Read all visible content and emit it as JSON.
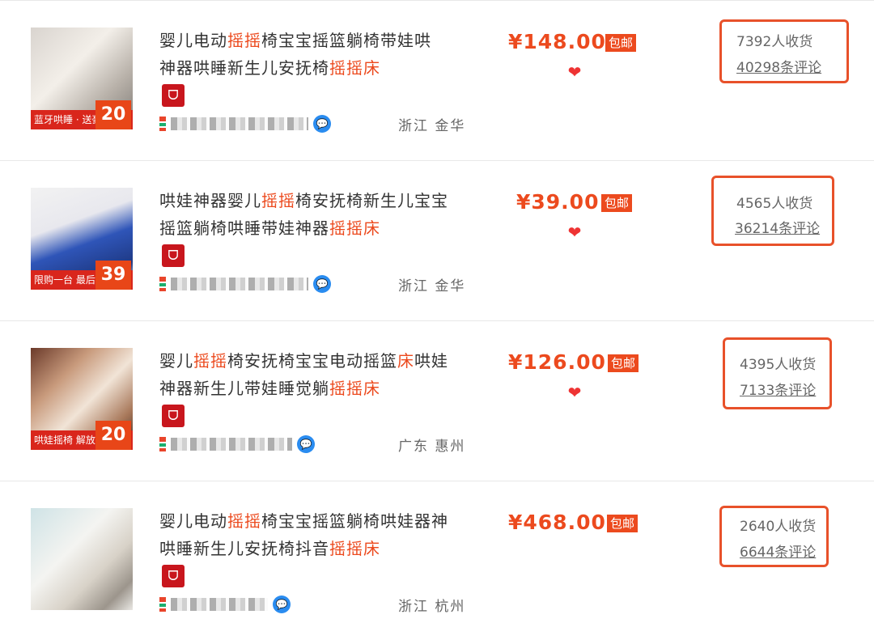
{
  "items": [
    {
      "title_parts": [
        "婴儿电动",
        "摇摇",
        "椅宝宝摇篮躺椅带娃哄",
        "神器哄睡新生儿安抚椅",
        "摇摇床"
      ],
      "thumb_banner": "蓝牙哄睡 · 送豪礼",
      "thumb_tag": "20",
      "price": "¥148.00",
      "free_shipping": "包邮",
      "location": "浙江 金华",
      "sold": "7392人收货",
      "reviews": "40298条评论"
    },
    {
      "title_parts": [
        "哄娃神器婴儿",
        "摇摇",
        "椅安抚椅新生儿宝宝",
        "摇篮躺椅哄睡带娃神器",
        "摇摇床"
      ],
      "thumb_banner": "限购一台 最后三天",
      "thumb_tag": "39",
      "price": "¥39.00",
      "free_shipping": "包邮",
      "location": "浙江 金华",
      "sold": "4565人收货",
      "reviews": "36214条评论"
    },
    {
      "title_parts": [
        "婴儿",
        "摇摇",
        "椅安抚椅宝宝电动摇篮",
        "床",
        "哄娃",
        "神器新生儿带娃睡觉躺",
        "摇摇床"
      ],
      "thumb_banner": "哄娃摇椅 解放双手",
      "thumb_tag": "20",
      "price": "¥126.00",
      "free_shipping": "包邮",
      "location": "广东 惠州",
      "sold": "4395人收货",
      "reviews": "7133条评论"
    },
    {
      "title_parts": [
        "婴儿电动",
        "摇摇",
        "椅宝宝摇篮躺椅哄娃器神",
        "哄睡新生儿安抚椅抖音",
        "摇摇床"
      ],
      "thumb_banner": "",
      "thumb_tag": "",
      "price": "¥468.00",
      "free_shipping": "包邮",
      "location": "浙江 杭州",
      "sold": "2640人收货",
      "reviews": "6644条评论"
    }
  ],
  "colors": {
    "accent": "#ec4a1e",
    "highlight_box": "#e8512a",
    "shop_badge": "#c8161d"
  },
  "icons": [
    "tmall-badge-icon",
    "wangwang-chat-icon",
    "heart-badge-icon"
  ]
}
